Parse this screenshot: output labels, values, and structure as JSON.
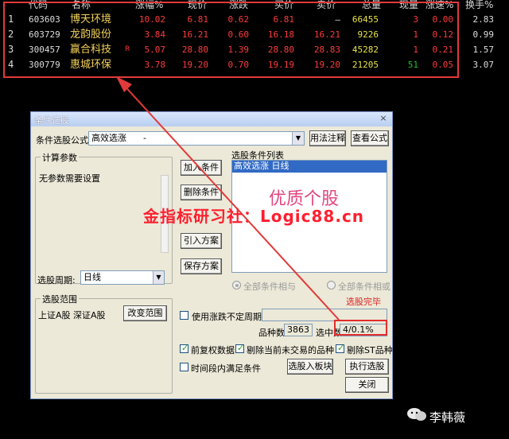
{
  "table": {
    "headers": [
      "代码",
      "名称",
      "涨幅%",
      "现价",
      "涨跌",
      "买价",
      "卖价",
      "总量",
      "现量",
      "涨速%",
      "换手%"
    ],
    "rows": [
      {
        "idx": "1",
        "code": "603603",
        "name": "博天环境",
        "flag": "",
        "chg_pct": "10.02",
        "price": "6.81",
        "chg": "0.62",
        "bid": "6.81",
        "ask": "—",
        "vol": "66455",
        "cur_vol": "3",
        "speed": "0.00",
        "turnover": "2.83"
      },
      {
        "idx": "2",
        "code": "603729",
        "name": "龙韵股份",
        "flag": "",
        "chg_pct": "3.84",
        "price": "16.21",
        "chg": "0.60",
        "bid": "16.18",
        "ask": "16.21",
        "vol": "9226",
        "cur_vol": "1",
        "speed": "0.12",
        "turnover": "0.99"
      },
      {
        "idx": "3",
        "code": "300457",
        "name": "赢合科技",
        "flag": "R",
        "chg_pct": "5.07",
        "price": "28.80",
        "chg": "1.39",
        "bid": "28.80",
        "ask": "28.83",
        "vol": "45282",
        "cur_vol": "1",
        "speed": "0.21",
        "turnover": "1.57"
      },
      {
        "idx": "4",
        "code": "300779",
        "name": "惠城环保",
        "flag": "",
        "chg_pct": "3.78",
        "price": "19.20",
        "chg": "0.70",
        "bid": "19.19",
        "ask": "19.20",
        "vol": "21205",
        "cur_vol": "51",
        "speed": "0.05",
        "turnover": "3.07"
      }
    ],
    "colors": {
      "up": "#ff3b3b",
      "name": "#f5d35a",
      "vol": "#e8e34a",
      "cur_vol_up": "#21c321",
      "cur_vol_down": "#ff3b3b",
      "plain": "#dddddd"
    }
  },
  "dialog": {
    "title": "条件选股",
    "formula_label": "条件选股公式",
    "formula_value": "高效选涨",
    "formula_sep": "-",
    "usage_button": "用法注释",
    "view_formula_button": "查看公式",
    "params_group": "计算参数",
    "params_text": "无参数需要设置",
    "add_condition": "加入条件",
    "delete_condition": "删除条件",
    "import_plan": "引入方案",
    "save_plan": "保存方案",
    "condition_list_label": "选股条件列表",
    "condition_item": "高效选涨  日线",
    "big_text": "优质个股",
    "period_label": "选股周期:",
    "period_value": "日线",
    "radio_and": "全部条件相与",
    "radio_or": "全部条件相或",
    "done_text": "选股完毕",
    "range_group": "选股范围",
    "range_text": "上证A股 深证A股",
    "change_range": "改变范围",
    "use_unfixed": "使用涨跌不定周期",
    "count_label": "品种数",
    "count_value": "3863",
    "selected_label": "选中数",
    "selected_value": "4/0.1%",
    "forward_adj": "前复权数据",
    "exclude_untraded": "剔除当前未交易的品种",
    "exclude_st": "剔除ST品种",
    "time_satisfy": "时间段内满足条件",
    "to_block": "选股入板块",
    "execute": "执行选股",
    "close": "关闭",
    "close_icon": "×"
  },
  "watermark": "金指标研习社：Logic88.cn",
  "author": "李韩薇",
  "accent_red": "#e23a3a"
}
